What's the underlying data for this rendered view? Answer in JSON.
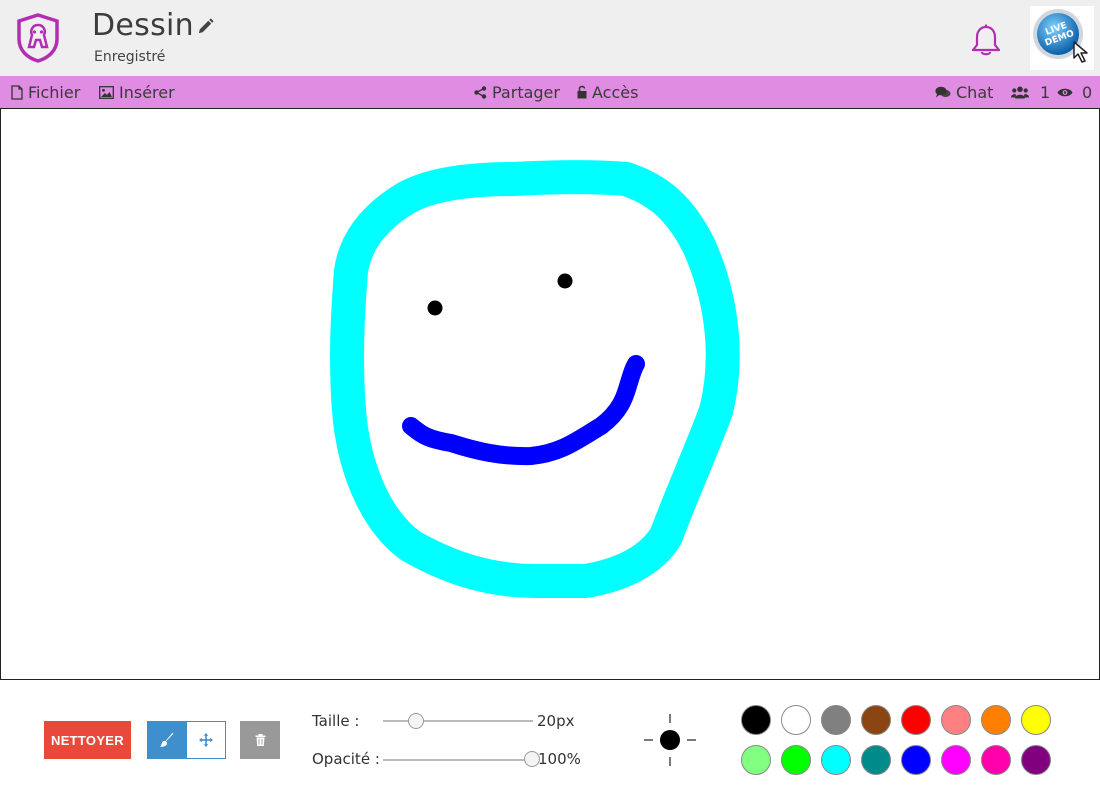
{
  "header": {
    "title": "Dessin",
    "status": "Enregistré",
    "demo_badge": "LIVE DEMO"
  },
  "toolbar": {
    "file_label": "Fichier",
    "insert_label": "Insérer",
    "share_label": "Partager",
    "access_label": "Accès",
    "chat_label": "Chat",
    "users_count": "1",
    "viewers_count": "0"
  },
  "tools": {
    "clear_label": "NETTOYER",
    "size_label": "Taille :",
    "size_value": "20px",
    "size_level": 0.2,
    "opacity_label": "Opacité :",
    "opacity_value": "100%",
    "opacity_level": 1.0,
    "current_color": "#000000"
  },
  "palette": [
    "#000000",
    "#ffffff",
    "#808080",
    "#8b4513",
    "#ff0000",
    "#ff8080",
    "#ff8000",
    "#ffff00",
    "#80ff80",
    "#00ff00",
    "#00ffff",
    "#008b8b",
    "#0000ff",
    "#ff00ff",
    "#ff00aa",
    "#800080"
  ],
  "colors": {
    "header_bg": "#efefef",
    "toolbar_bg": "#e08ce2",
    "accent_purple": "#b22db4",
    "clear_button": "#e8493a",
    "tool_blue": "#3e8fcb"
  }
}
